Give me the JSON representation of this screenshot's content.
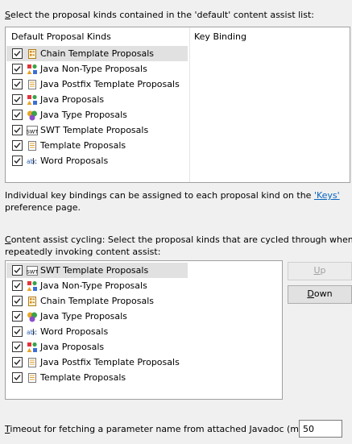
{
  "section1": {
    "label_pre": "",
    "label_u": "S",
    "label_post": "elect the proposal kinds contained in the 'default' content assist list:",
    "col_kinds": "Default Proposal Kinds",
    "col_binding": "Key Binding",
    "items": [
      {
        "label": "Chain Template Proposals",
        "icon": "chain-template-icon",
        "checked": true
      },
      {
        "label": "Java Non-Type Proposals",
        "icon": "java-non-type-icon",
        "checked": true
      },
      {
        "label": "Java Postfix Template Proposals",
        "icon": "postfix-template-icon",
        "checked": true
      },
      {
        "label": "Java Proposals",
        "icon": "java-proposals-icon",
        "checked": true
      },
      {
        "label": "Java Type Proposals",
        "icon": "java-type-icon",
        "checked": true
      },
      {
        "label": "SWT Template Proposals",
        "icon": "swt-template-icon",
        "checked": true
      },
      {
        "label": "Template Proposals",
        "icon": "template-icon",
        "checked": true
      },
      {
        "label": "Word Proposals",
        "icon": "word-icon",
        "checked": true
      }
    ]
  },
  "note": {
    "line1_pre": "Individual key bindings can be assigned to each proposal kind on the ",
    "link": "'Keys'",
    "line2": "preference page."
  },
  "section2": {
    "label_line1_u": "C",
    "label_line1_rest": "ontent assist cycling: Select the proposal kinds that are cycled through when",
    "label_line2": "repeatedly invoking content assist:",
    "items": [
      {
        "label": "SWT Template Proposals",
        "icon": "swt-template-icon",
        "checked": true
      },
      {
        "label": "Java Non-Type Proposals",
        "icon": "java-non-type-icon",
        "checked": true
      },
      {
        "label": "Chain Template Proposals",
        "icon": "chain-template-icon",
        "checked": true
      },
      {
        "label": "Java Type Proposals",
        "icon": "java-type-icon",
        "checked": true
      },
      {
        "label": "Word Proposals",
        "icon": "word-icon",
        "checked": true
      },
      {
        "label": "Java Proposals",
        "icon": "java-proposals-icon",
        "checked": true
      },
      {
        "label": "Java Postfix Template Proposals",
        "icon": "postfix-template-icon",
        "checked": true
      },
      {
        "label": "Template Proposals",
        "icon": "template-icon",
        "checked": true
      }
    ],
    "up_u": "U",
    "up_rest": "p",
    "down_u": "D",
    "down_rest": "own"
  },
  "timeout": {
    "label_u": "T",
    "label_rest": "imeout for fetching a parameter name from attached Javadoc (ms):",
    "value": "50"
  }
}
